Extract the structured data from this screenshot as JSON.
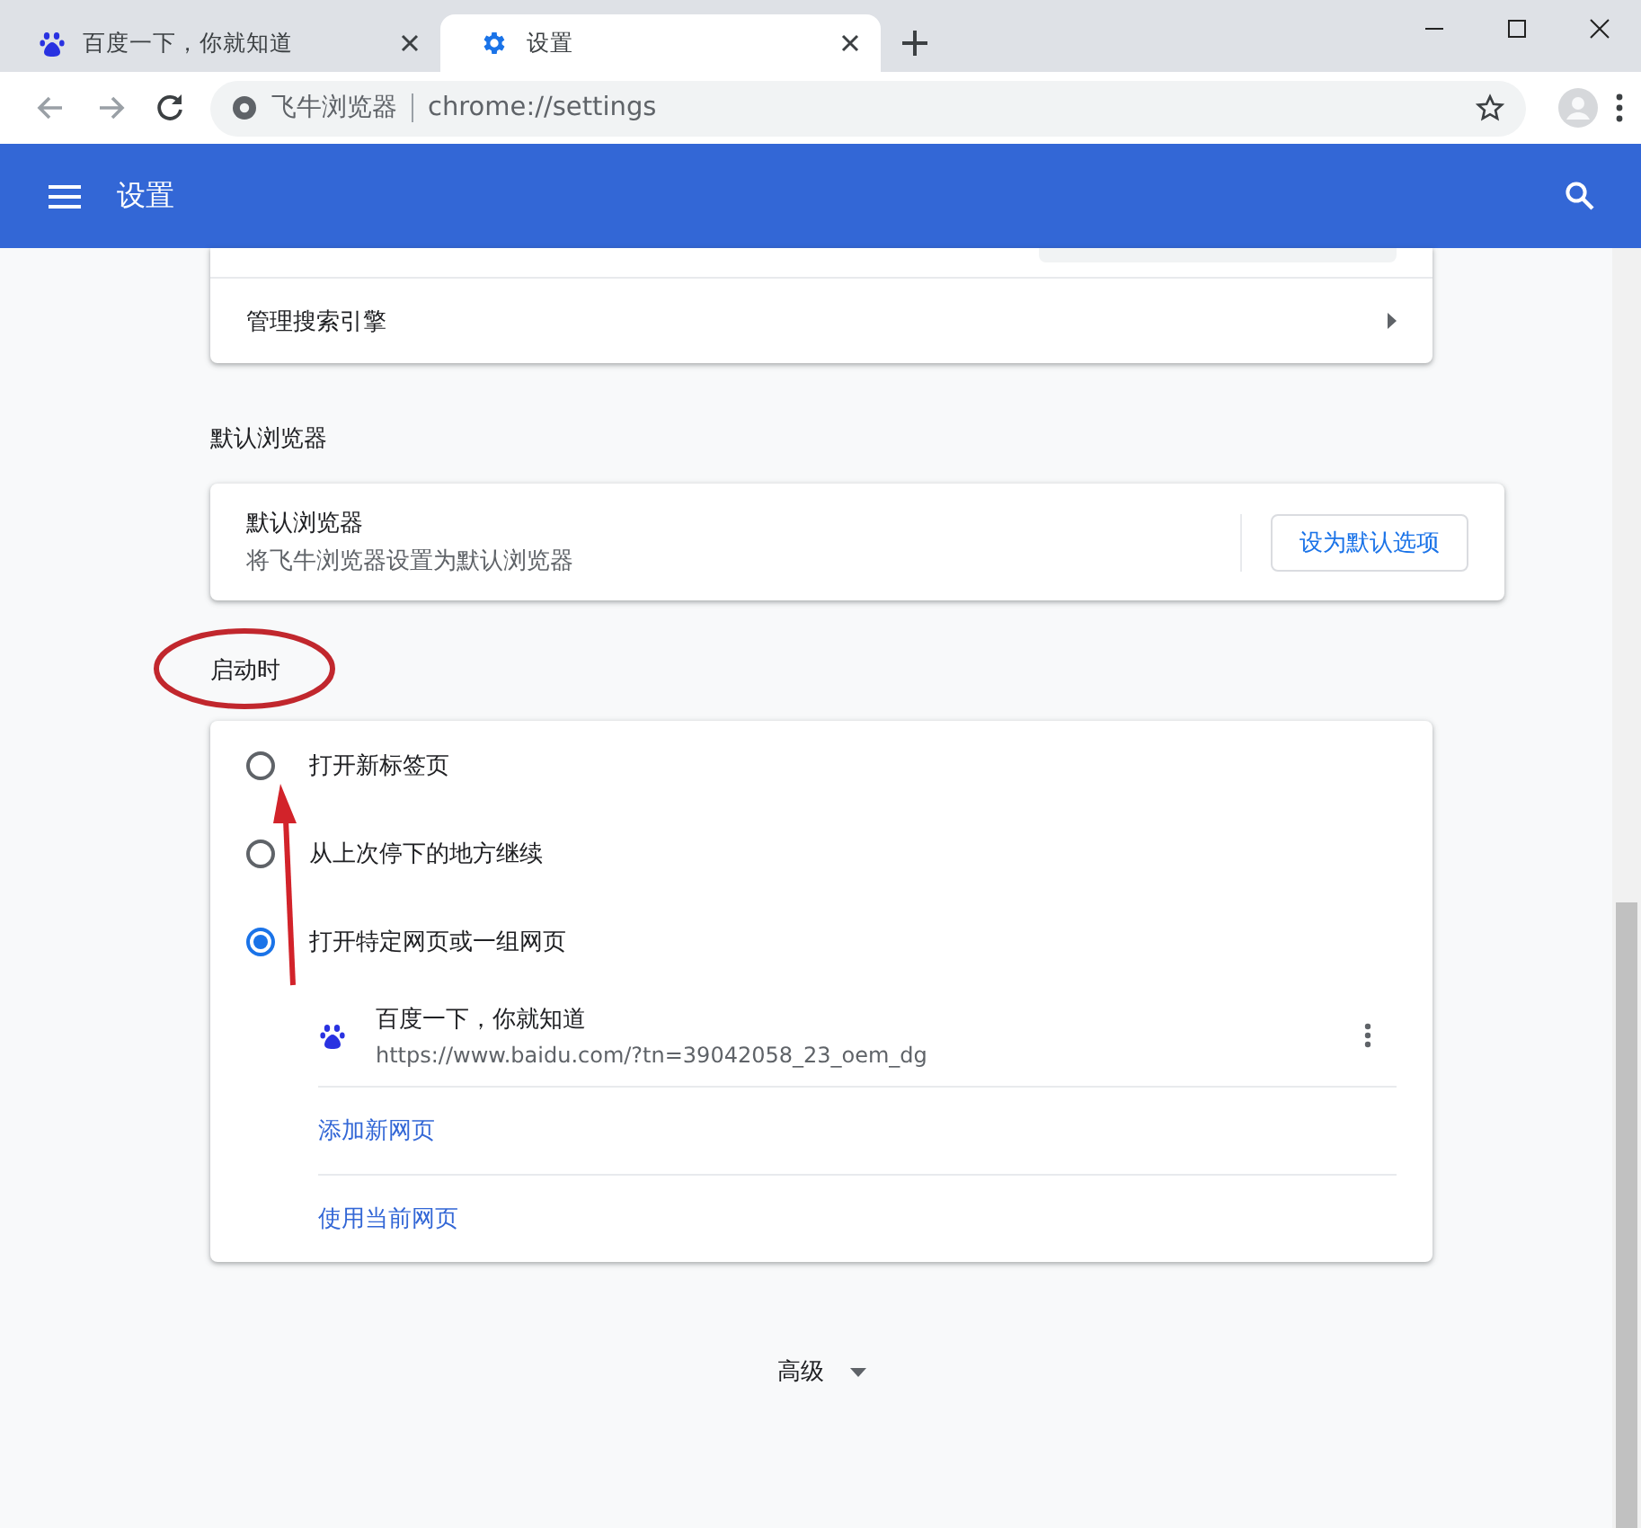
{
  "tabs": [
    {
      "title": "百度一下，你就知道",
      "kind": "site",
      "selected": false
    },
    {
      "title": "设置",
      "kind": "settings",
      "selected": true
    }
  ],
  "toolbar": {
    "site_label": "飞牛浏览器",
    "url": "chrome://settings"
  },
  "header": {
    "title": "设置"
  },
  "search_engine": {
    "manage_label": "管理搜索引擎"
  },
  "default_browser": {
    "section_title": "默认浏览器",
    "label": "默认浏览器",
    "description": "将飞牛浏览器设置为默认浏览器",
    "button": "设为默认选项"
  },
  "on_startup": {
    "section_title": "启动时",
    "options": [
      {
        "label": "打开新标签页",
        "selected": false
      },
      {
        "label": "从上次停下的地方继续",
        "selected": false
      },
      {
        "label": "打开特定网页或一组网页",
        "selected": true
      }
    ],
    "pages": [
      {
        "title": "百度一下，你就知道",
        "url": "https://www.baidu.com/?tn=39042058_23_oem_dg"
      }
    ],
    "add_link": "添加新网页",
    "use_current_link": "使用当前网页"
  },
  "advanced": {
    "label": "高级"
  }
}
